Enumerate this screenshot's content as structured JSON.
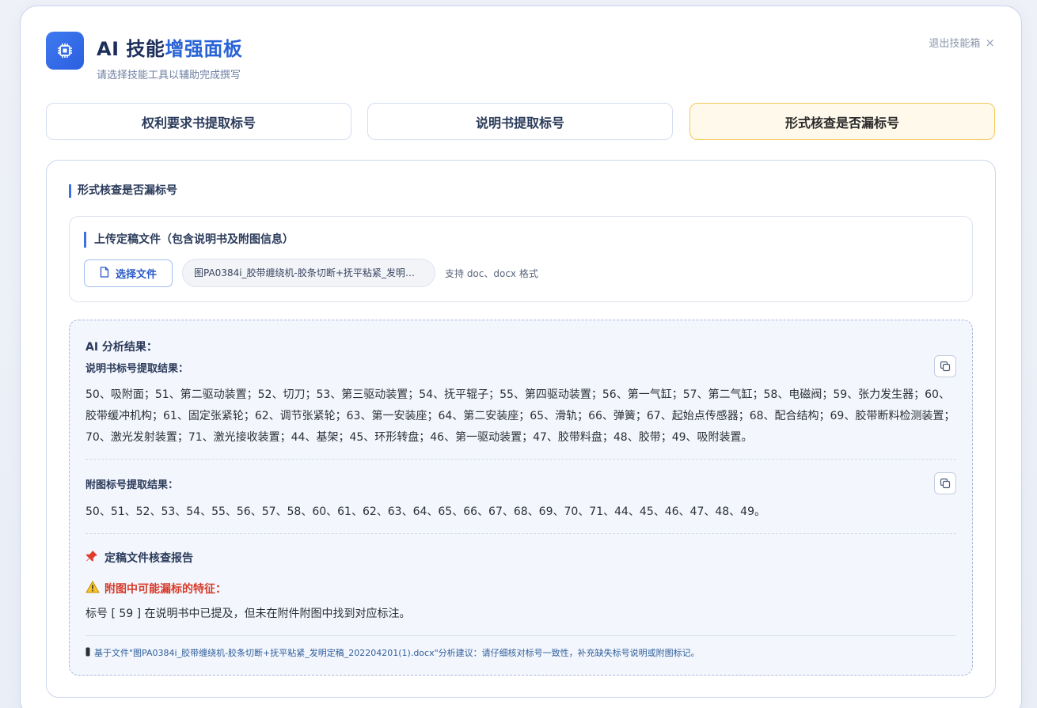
{
  "header": {
    "title_plain": "AI 技能",
    "title_accent": "增强面板",
    "subtitle": "请选择技能工具以辅助完成撰写",
    "exit_label": "退出技能箱",
    "exit_icon": "close-icon",
    "logo_icon": "chip-icon"
  },
  "tabs": [
    {
      "label": "权利要求书提取标号",
      "active": false
    },
    {
      "label": "说明书提取标号",
      "active": false
    },
    {
      "label": "形式核查是否漏标号",
      "active": true
    }
  ],
  "section": {
    "title": "形式核查是否漏标号",
    "upload": {
      "title": "上传定稿文件（包含说明书及附图信息）",
      "button_label": "选择文件",
      "button_icon": "file-icon",
      "file_name": "图PA0384i_胶带缠绕机-胶条切断+抚平粘紧_发明定稿_202204201(1).docx",
      "format_hint": "支持 doc、docx 格式"
    }
  },
  "result": {
    "heading": "AI 分析结果：",
    "spec_label": "说明书标号提取结果：",
    "spec_text": "50、吸附面；51、第二驱动装置；52、切刀；53、第三驱动装置；54、抚平辊子；55、第四驱动装置；56、第一气缸；57、第二气缸；58、电磁阀；59、张力发生器；60、胶带缓冲机构；61、固定张紧轮；62、调节张紧轮；63、第一安装座；64、第二安装座；65、滑轨；66、弹簧；67、起始点传感器；68、配合结构；69、胶带断料检测装置；70、激光发射装置；71、激光接收装置；44、基架；45、环形转盘；46、第一驱动装置；47、胶带料盘；48、胶带；49、吸附装置。",
    "drawing_label": "附图标号提取结果：",
    "drawing_text": "50、51、52、53、54、55、56、57、58、60、61、62、63、64、65、66、67、68、69、70、71、44、45、46、47、48、49。",
    "report_title": "定稿文件核查报告",
    "warn_title": "附图中可能漏标的特征：",
    "warn_text": "标号 [ 59 ] 在说明书中已提及，但未在附件附图中找到对应标注。",
    "footer_note": "基于文件\"图PA0384i_胶带缠绕机-胶条切断+抚平粘紧_发明定稿_202204201(1).docx\"分析建议：请仔细核对标号一致性，补充缺失标号说明或附图标记。"
  },
  "colors": {
    "accent": "#2a63d6",
    "active_tab_bg": "#fff9ec",
    "active_tab_border": "#f4c85a",
    "warning": "#d63b2a"
  }
}
